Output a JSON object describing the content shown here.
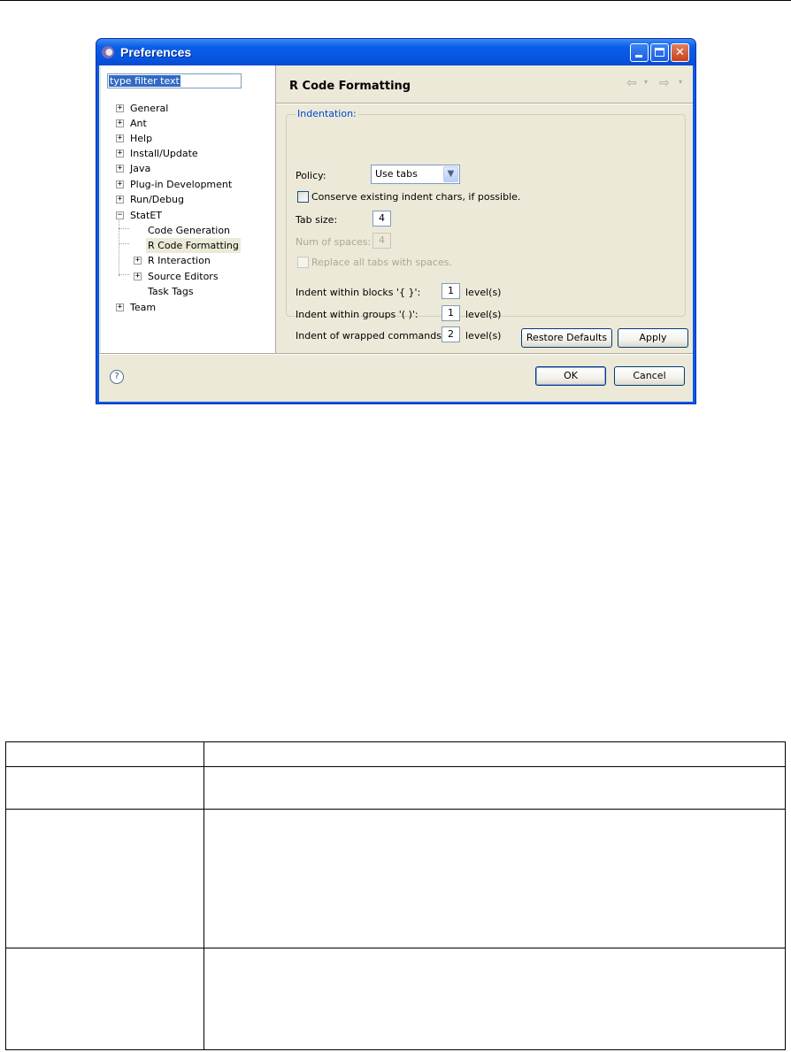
{
  "window": {
    "title": "Preferences",
    "buttons": {
      "minimize": "minimize",
      "maximize": "maximize",
      "close": "✕"
    }
  },
  "filter": {
    "value": "type filter text"
  },
  "tree": [
    {
      "label": "General",
      "expander": "+"
    },
    {
      "label": "Ant",
      "expander": "+"
    },
    {
      "label": "Help",
      "expander": "+"
    },
    {
      "label": "Install/Update",
      "expander": "+"
    },
    {
      "label": "Java",
      "expander": "+"
    },
    {
      "label": "Plug-in Development",
      "expander": "+"
    },
    {
      "label": "Run/Debug",
      "expander": "+"
    },
    {
      "label": "StatET",
      "expander": "−"
    },
    {
      "label": "Code Generation",
      "expander": ""
    },
    {
      "label": "R Code Formatting",
      "expander": "",
      "selected": true
    },
    {
      "label": "R Interaction",
      "expander": "+"
    },
    {
      "label": "Source Editors",
      "expander": "+"
    },
    {
      "label": "Task Tags",
      "expander": ""
    },
    {
      "label": "Team",
      "expander": "+"
    }
  ],
  "page": {
    "title": "R Code Formatting",
    "nav": {
      "back_icon": "⇦",
      "forward_icon": "⇨",
      "caret": "▾"
    },
    "indentation": {
      "legend": "Indentation:",
      "policy_label": "Policy:",
      "policy_value": "Use tabs",
      "conserve_label": "Conserve existing indent chars, if possible.",
      "tab_size_label": "Tab size:",
      "tab_size_value": "4",
      "num_spaces_label": "Num of spaces:",
      "num_spaces_value": "4",
      "replace_label": "Replace all tabs with spaces.",
      "blocks_label": "Indent within blocks '{ }':",
      "blocks_value": "1",
      "groups_label": "Indent within groups '( )':",
      "groups_value": "1",
      "wrapped_label": "Indent of wrapped commands:",
      "wrapped_value": "2",
      "level_unit": "level(s)"
    },
    "buttons": {
      "restore": "Restore Defaults",
      "apply": "Apply"
    }
  },
  "footer": {
    "help_icon": "?",
    "ok": "OK",
    "cancel": "Cancel"
  }
}
